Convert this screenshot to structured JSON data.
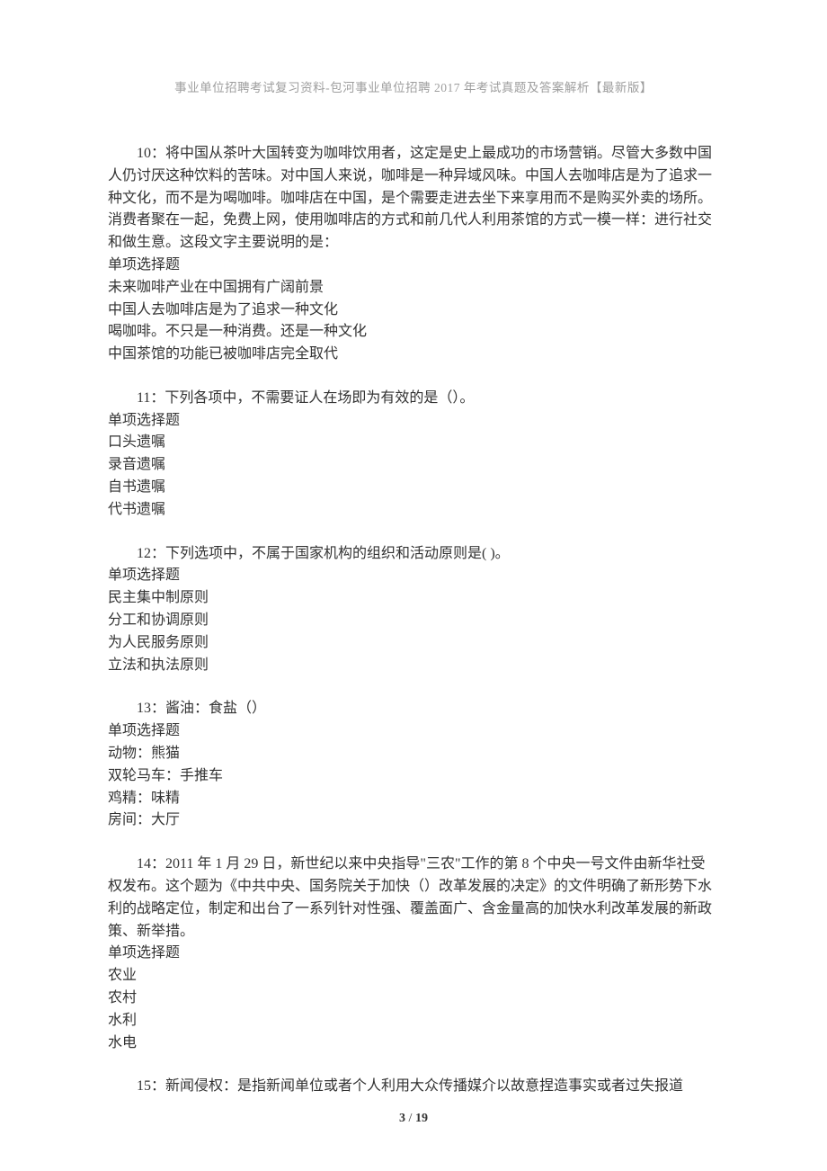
{
  "header": "事业单位招聘考试复习资料-包河事业单位招聘 2017 年考试真题及答案解析【最新版】",
  "questions": [
    {
      "stem": "10：将中国从茶叶大国转变为咖啡饮用者，这定是史上最成功的市场营销。尽管大多数中国人仍讨厌这种饮料的苦味。对中国人来说，咖啡是一种异域风味。中国人去咖啡店是为了追求一种文化，而不是为喝咖啡。咖啡店在中国，是个需要走进去坐下来享用而不是购买外卖的场所。消费者聚在一起，免费上网，使用咖啡店的方式和前几代人利用茶馆的方式一模一样：进行社交和做生意。这段文字主要说明的是：",
      "type": "单项选择题",
      "options": [
        "未来咖啡产业在中国拥有广阔前景",
        "中国人去咖啡店是为了追求一种文化",
        "喝咖啡。不只是一种消费。还是一种文化",
        "中国茶馆的功能已被咖啡店完全取代"
      ]
    },
    {
      "stem": "11：下列各项中，不需要证人在场即为有效的是（）。",
      "type": "单项选择题",
      "options": [
        "口头遗嘱",
        "录音遗嘱",
        "自书遗嘱",
        "代书遗嘱"
      ]
    },
    {
      "stem": "12：下列选项中，不属于国家机构的组织和活动原则是( )。",
      "type": "单项选择题",
      "options": [
        "民主集中制原则",
        "分工和协调原则",
        "为人民服务原则",
        "立法和执法原则"
      ]
    },
    {
      "stem": "13：酱油：食盐（）",
      "type": "单项选择题",
      "options": [
        "动物：熊猫",
        "双轮马车：手推车",
        "鸡精：味精",
        "房间：大厅"
      ]
    },
    {
      "stem": "14：2011 年 1 月 29 日，新世纪以来中央指导\"三农\"工作的第 8 个中央一号文件由新华社受权发布。这个题为《中共中央、国务院关于加快（）改革发展的决定》的文件明确了新形势下水利的战略定位，制定和出台了一系列针对性强、覆盖面广、含金量高的加快水利改革发展的新政策、新举措。",
      "type": "单项选择题",
      "options": [
        "农业",
        "农村",
        "水利",
        "水电"
      ]
    },
    {
      "stem": "15：新闻侵权：是指新闻单位或者个人利用大众传播媒介以故意捏造事实或者过失报道",
      "type": "",
      "options": []
    }
  ],
  "footer": {
    "current": "3",
    "sep": " / ",
    "total": "19"
  }
}
